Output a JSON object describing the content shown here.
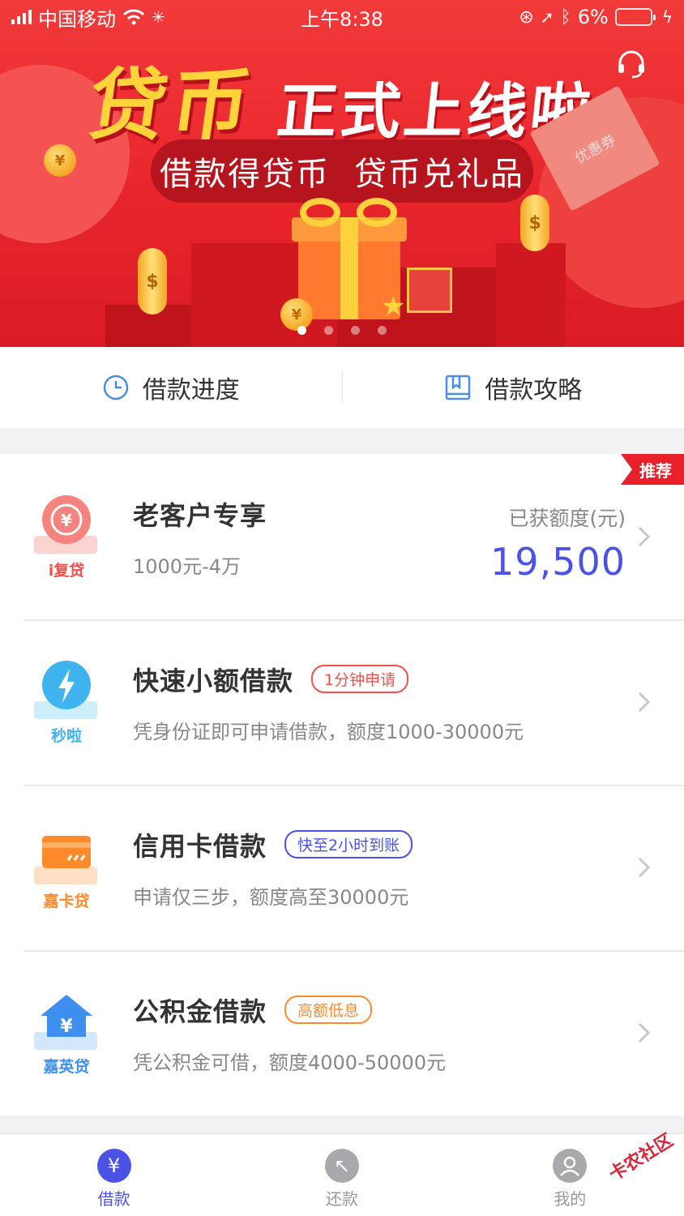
{
  "status_bar": {
    "carrier": "中国移动",
    "time": "上午8:38",
    "battery": "6%"
  },
  "banner": {
    "title_main": "贷币",
    "title_sub": "正式上线啦",
    "slogan_1": "借款得贷币",
    "slogan_2": "贷币兑礼品",
    "coupon_text": "优惠券",
    "page_count": 4,
    "active_page": 1
  },
  "quick_nav": {
    "progress_label": "借款进度",
    "guide_label": "借款攻略"
  },
  "loans": [
    {
      "icon": "ifudai-icon",
      "brand": "i复贷",
      "title": "老客户专享",
      "desc": "1000元-4万",
      "tag": "",
      "quota_label": "已获额度(元)",
      "quota_value": "19,500",
      "badge": "推荐",
      "color": "#f0504a"
    },
    {
      "icon": "lightning-icon",
      "brand": "秒啦",
      "title": "快速小额借款",
      "tag": "1分钟申请",
      "desc": "凭身份证即可申请借款，额度1000-30000元",
      "color": "#3fb4ef",
      "tag_color": "#f0504a"
    },
    {
      "icon": "credit-card-icon",
      "brand": "嘉卡贷",
      "title": "信用卡借款",
      "tag": "快至2小时到账",
      "desc": "申请仅三步，额度高至30000元",
      "color": "#ff8a2a",
      "tag_color": "#4b53e6"
    },
    {
      "icon": "house-icon",
      "brand": "嘉英贷",
      "title": "公积金借款",
      "tag": "高额低息",
      "desc": "凭公积金可借，额度4000-50000元",
      "color": "#3f8ff0",
      "tag_color": "#ff8a2a"
    }
  ],
  "tabs": [
    {
      "label": "借款",
      "icon": "yen-icon",
      "active": true
    },
    {
      "label": "还款",
      "icon": "return-arrow-icon",
      "active": false
    },
    {
      "label": "我的",
      "icon": "user-icon",
      "active": false
    }
  ],
  "watermark": "卡农社区",
  "colors": {
    "primary": "#4b53e6",
    "banner_red": "#e8242b",
    "badge_red": "#e8202a"
  }
}
